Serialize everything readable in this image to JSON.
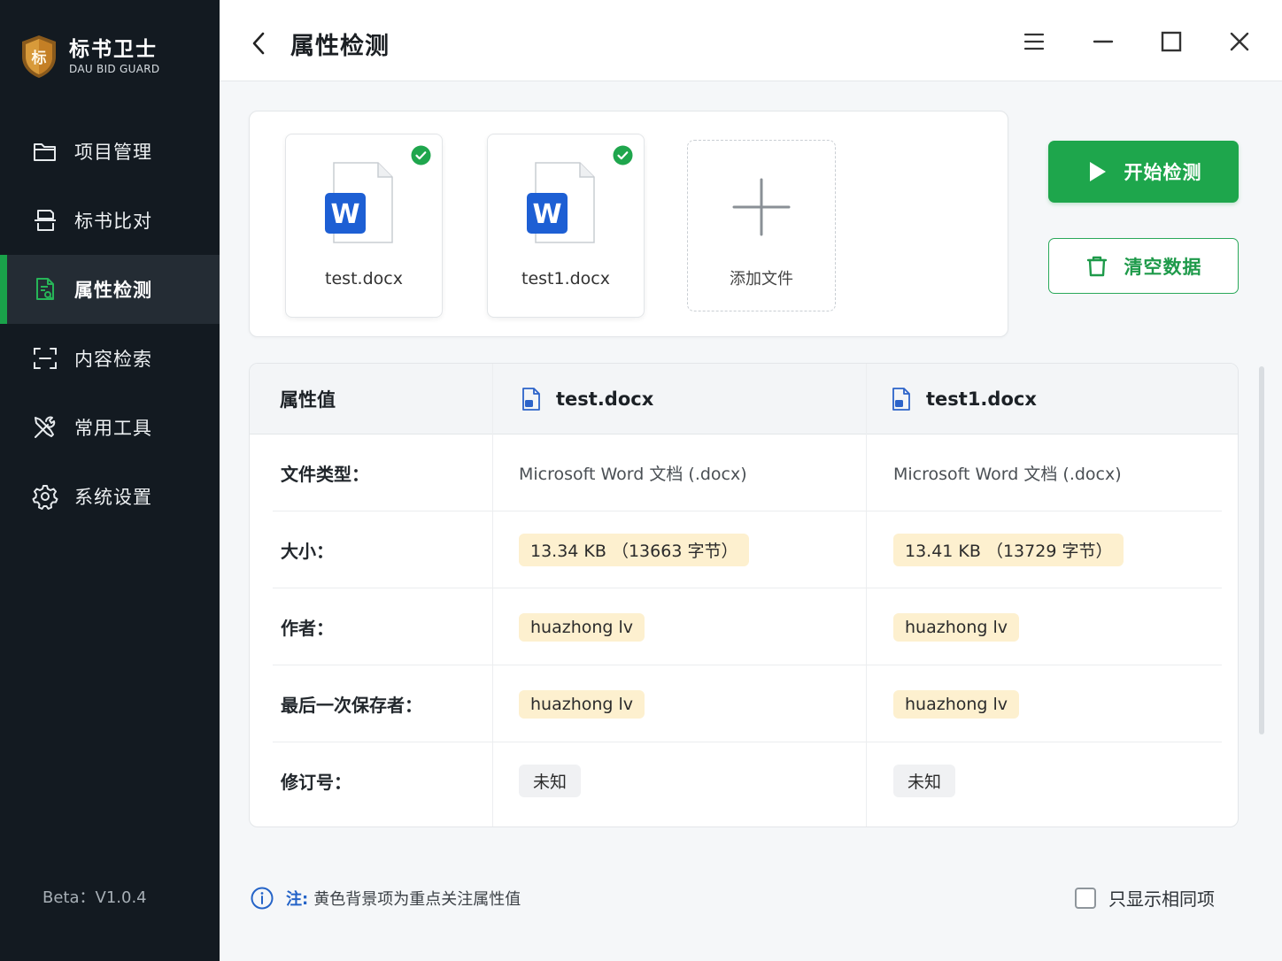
{
  "brand": {
    "name": "标书卫士",
    "subtitle": "DAU BID GUARD",
    "logo_char": "标"
  },
  "sidebar": {
    "items": [
      {
        "label": "项目管理",
        "icon": "folder-icon"
      },
      {
        "label": "标书比对",
        "icon": "compare-icon"
      },
      {
        "label": "属性检测",
        "icon": "file-search-icon",
        "active": true
      },
      {
        "label": "内容检索",
        "icon": "scan-icon"
      },
      {
        "label": "常用工具",
        "icon": "tools-icon"
      },
      {
        "label": "系统设置",
        "icon": "gear-icon"
      }
    ],
    "version": "Beta：V1.0.4"
  },
  "header": {
    "title": "属性检测"
  },
  "files": [
    {
      "name": "test.docx",
      "checked": true
    },
    {
      "name": "test1.docx",
      "checked": true
    }
  ],
  "add_file": {
    "label": "添加文件"
  },
  "actions": {
    "start_label": "开始检测",
    "clear_label": "清空数据"
  },
  "table": {
    "header_label": "属性值",
    "columns": [
      "test.docx",
      "test1.docx"
    ],
    "rows": [
      {
        "label": "文件类型：",
        "values": [
          "Microsoft Word 文档 (.docx)",
          "Microsoft Word 文档 (.docx)"
        ],
        "style": "plain"
      },
      {
        "label": "大小：",
        "values": [
          "13.34 KB （13663 字节）",
          "13.41 KB （13729 字节）"
        ],
        "style": "yellow"
      },
      {
        "label": "作者：",
        "values": [
          "huazhong lv",
          "huazhong lv"
        ],
        "style": "yellow"
      },
      {
        "label": "最后一次保存者：",
        "values": [
          "huazhong lv",
          "huazhong lv"
        ],
        "style": "yellow"
      },
      {
        "label": "修订号：",
        "values": [
          "未知",
          "未知"
        ],
        "style": "grey"
      }
    ]
  },
  "footer": {
    "note_prefix": "注:",
    "note_text": "黄色背景项为重点关注属性值",
    "only_same_label": "只显示相同项",
    "only_same_checked": false
  },
  "colors": {
    "accent": "#1ea64c",
    "sidebar_bg": "#131a21",
    "highlight": "#fdf0cf",
    "info": "#2564c8"
  }
}
